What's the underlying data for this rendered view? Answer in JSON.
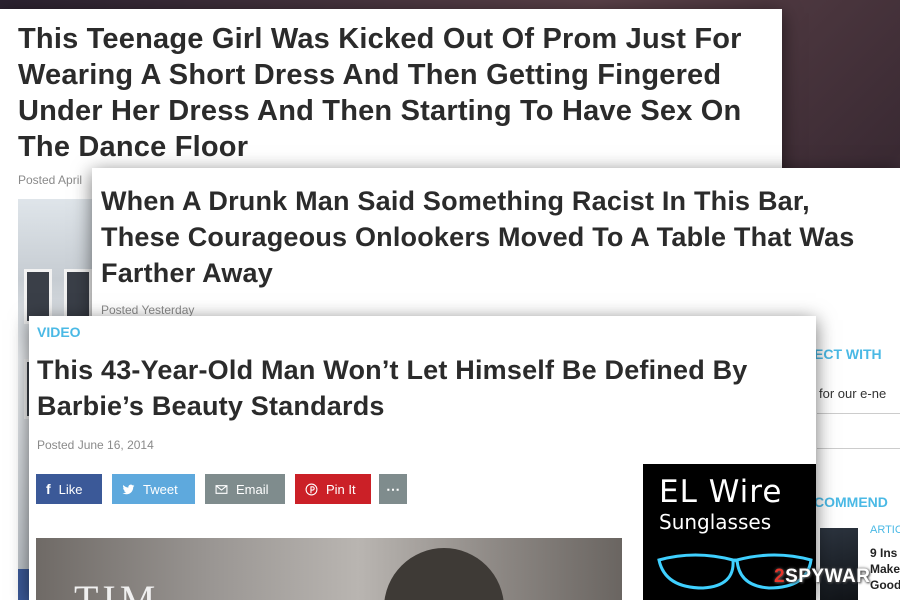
{
  "card1": {
    "headline": "This Teenage Girl Was Kicked Out Of Prom Just For Wearing A Short Dress And Then Getting Fingered Under Her Dress And Then Starting To Have Sex On The Dance Floor",
    "posted": "Posted April"
  },
  "card2": {
    "headline": "When A Drunk Man Said Something Racist In This Bar, These Courageous Onlookers Moved To A Table That Was Farther Away",
    "posted": "Posted Yesterday",
    "sidebar": {
      "connect_heading": "ECT WITH",
      "newsletter_text": "for our e-ne",
      "recommended_heading": "COMMEND",
      "article_tag": "ARTIC",
      "article_lines": [
        "9 Ins",
        "Make",
        "Good"
      ]
    }
  },
  "card3": {
    "tag": "VIDEO",
    "headline": "This 43-Year-Old Man Won’t Let Himself Be Defined By Barbie’s Beauty Standards",
    "posted": "Posted June 16, 2014",
    "share_buttons": [
      {
        "label": "Like",
        "icon": "facebook-icon",
        "color": "#3b5998"
      },
      {
        "label": "Tweet",
        "icon": "twitter-icon",
        "color": "#5ea9dd"
      },
      {
        "label": "Email",
        "icon": "email-icon",
        "color": "#7f8c8d"
      },
      {
        "label": "Pin It",
        "icon": "pinterest-icon",
        "color": "#cb2027"
      },
      {
        "label": "",
        "icon": "more-icon",
        "color": "#7f8c8d"
      }
    ],
    "ad": {
      "title": "EL Wire",
      "subtitle": "Sunglasses"
    },
    "photo_text": "TIM"
  },
  "watermark": {
    "prefix": "2",
    "rest": "SPYWAR"
  }
}
